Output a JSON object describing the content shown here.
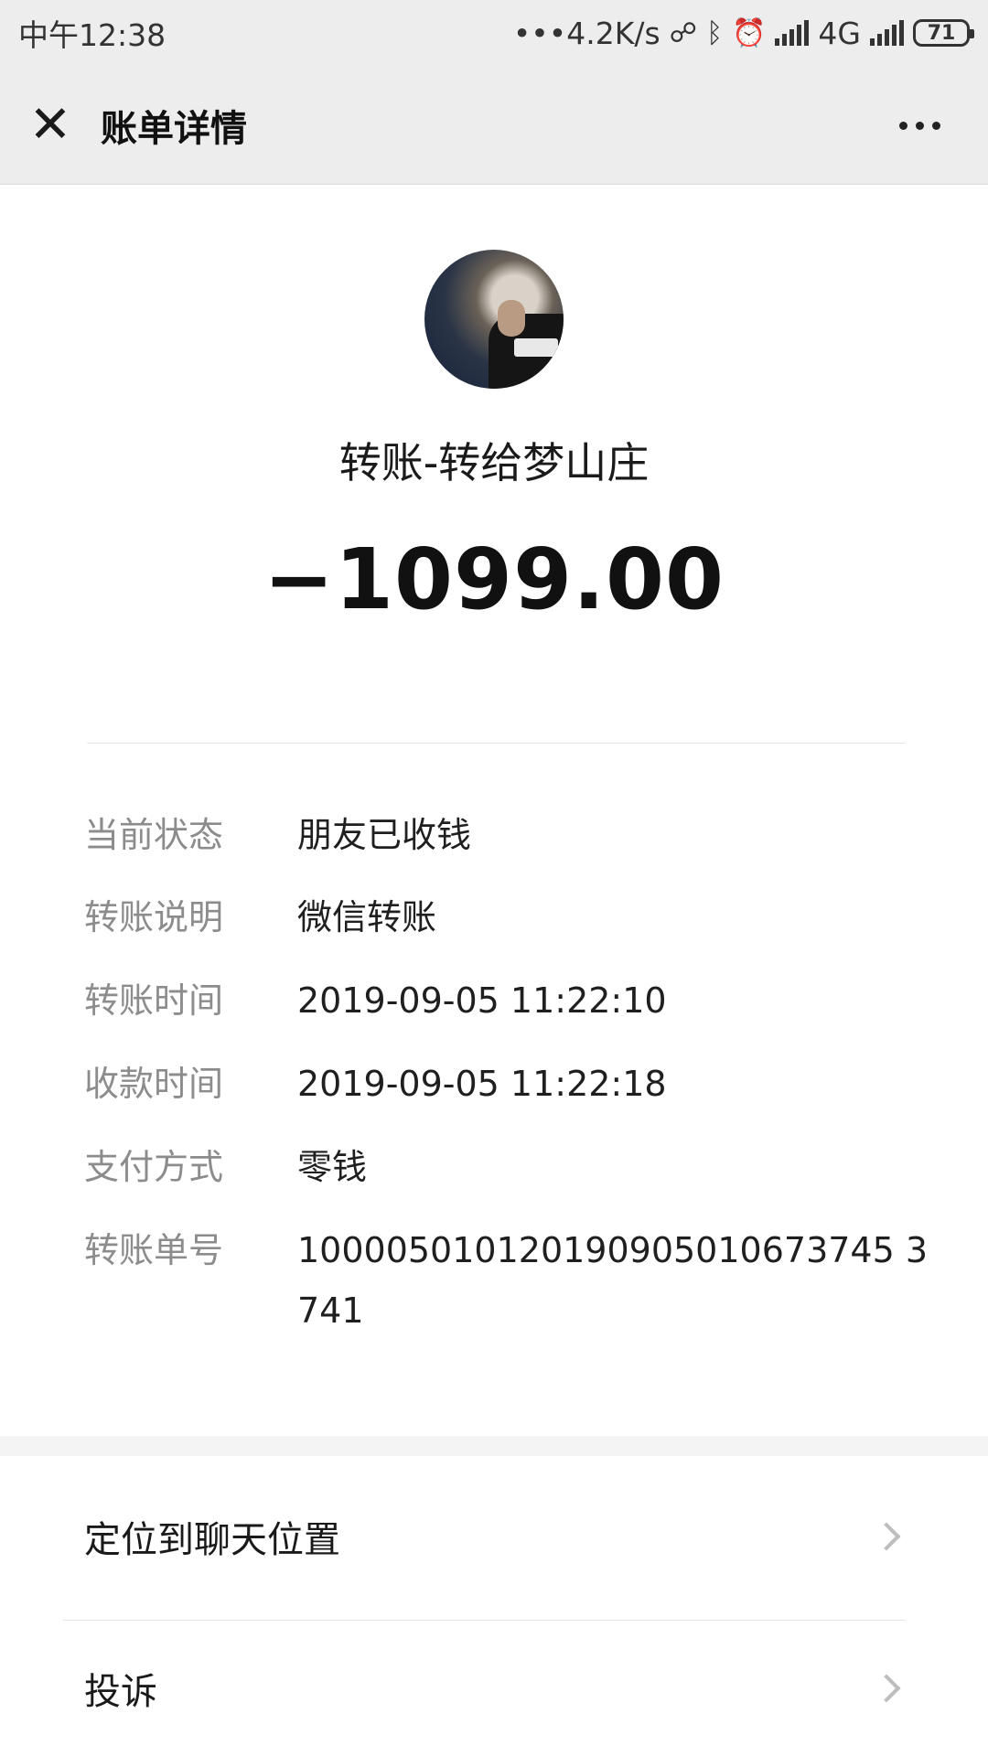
{
  "status_bar": {
    "time": "中午12:38",
    "network_speed": "•••4.2K/s",
    "network_type": "4G",
    "battery": "71",
    "icons": [
      "link-icon",
      "bluetooth-icon",
      "alarm-icon",
      "signal-icon",
      "signal-icon"
    ]
  },
  "nav": {
    "close_icon": "✕",
    "title": "账单详情",
    "more_icon": "more-icon"
  },
  "transaction": {
    "title": "转账-转给梦山庄",
    "amount": "−1099.00"
  },
  "details": [
    {
      "label": "当前状态",
      "value": "朋友已收钱"
    },
    {
      "label": "转账说明",
      "value": "微信转账"
    },
    {
      "label": "转账时间",
      "value": "2019-09-05 11:22:10"
    },
    {
      "label": "收款时间",
      "value": "2019-09-05 11:22:18"
    },
    {
      "label": "支付方式",
      "value": "零钱"
    },
    {
      "label": "转账单号",
      "value": "100005010120190905010673745 3741"
    }
  ],
  "actions": [
    {
      "label": "定位到聊天位置"
    },
    {
      "label": "投诉"
    }
  ]
}
